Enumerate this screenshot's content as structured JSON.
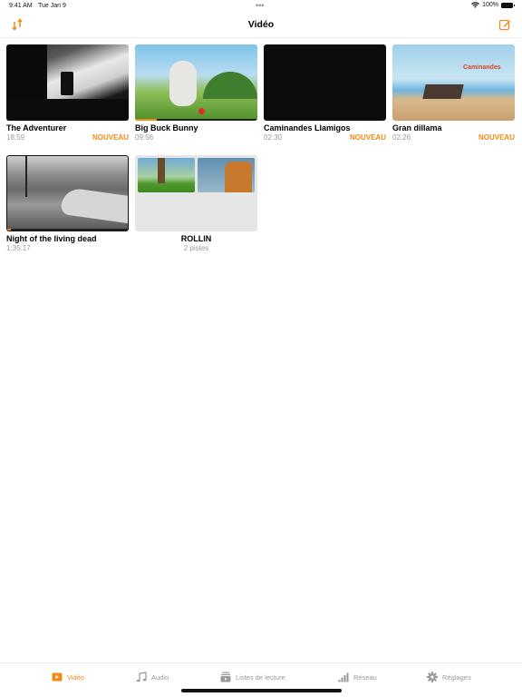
{
  "status_bar": {
    "time": "9:41 AM",
    "date": "Tue Jan 9",
    "battery": "100%",
    "icons": [
      "wifi-icon",
      "battery-icon"
    ]
  },
  "header": {
    "title": "Vidéo",
    "left_icon": "sort-icon",
    "right_icon": "edit-icon"
  },
  "videos": [
    {
      "title": "The Adventurer",
      "duration": "18:59",
      "badge": "NOUVEAU",
      "progress": null
    },
    {
      "title": "Big Buck Bunny",
      "duration": "09:56",
      "badge": "",
      "progress": 0.18
    },
    {
      "title": "Caminandes Llamigos",
      "duration": "02:30",
      "badge": "NOUVEAU",
      "progress": null
    },
    {
      "title": "Gran dillama",
      "duration": "02:26",
      "badge": "NOUVEAU",
      "progress": null,
      "thumb_text": "Caminandes"
    },
    {
      "title": "Night of the living dead",
      "duration": "1:35:17",
      "badge": "",
      "progress": 0.03
    }
  ],
  "collection": {
    "title": "ROLLIN",
    "subtitle": "2 pistes"
  },
  "tab_bar": {
    "tabs": [
      {
        "label": "Vidéo",
        "icon": "play-icon",
        "active": true
      },
      {
        "label": "Audio",
        "icon": "music-note-icon",
        "active": false
      },
      {
        "label": "Listes de lecture",
        "icon": "playlist-icon",
        "active": false
      },
      {
        "label": "Réseau",
        "icon": "network-icon",
        "active": false
      },
      {
        "label": "Réglages",
        "icon": "gear-icon",
        "active": false
      }
    ]
  },
  "colors": {
    "accent": "#f28a16",
    "secondary_text": "#9a9a9a"
  }
}
